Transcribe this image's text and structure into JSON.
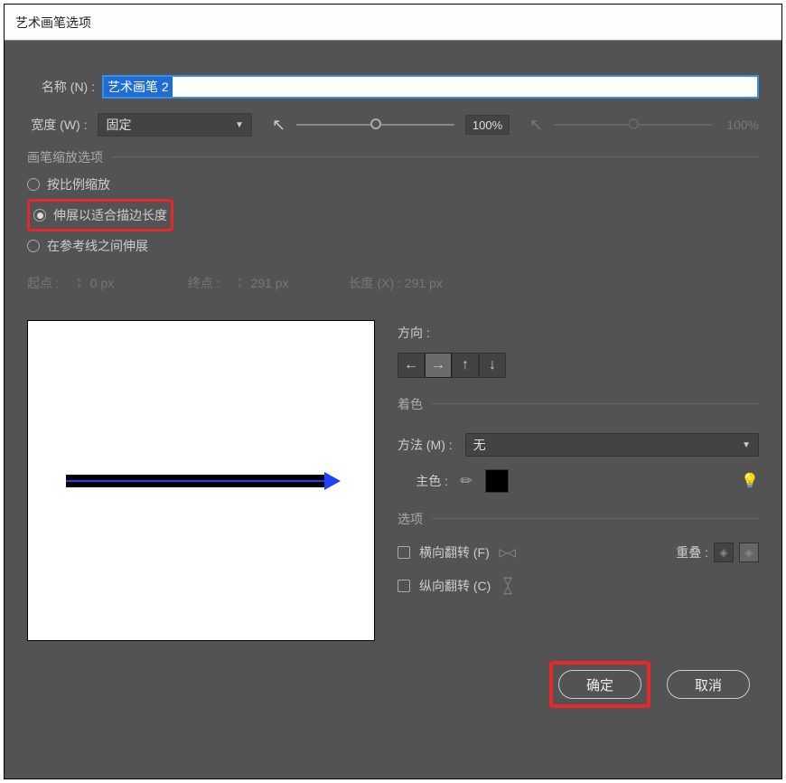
{
  "title": "艺术画笔选项",
  "name_label": "名称 (N) :",
  "name_value": "艺术画笔 2",
  "width_label": "宽度 (W) :",
  "width_mode": "固定",
  "width_pct": "100%",
  "width_pct2": "100%",
  "scale_group": "画笔缩放选项",
  "radio_proportional": "按比例缩放",
  "radio_stretch": "伸展以适合描边长度",
  "radio_guides": "在参考线之间伸展",
  "start_label": "起点 :",
  "start_value": "0 px",
  "end_label": "终点 :",
  "end_value": "291 px",
  "length_label": "长度 (X) :  291 px",
  "direction_title": "方向 :",
  "coloring_title": "着色",
  "method_label": "方法 (M) :",
  "method_value": "无",
  "maincolor_label": "主色 :",
  "options_title": "选项",
  "flip_h": "横向翻转 (F)",
  "flip_v": "纵向翻转 (C)",
  "overlap_label": "重叠 :",
  "ok": "确定",
  "cancel": "取消"
}
